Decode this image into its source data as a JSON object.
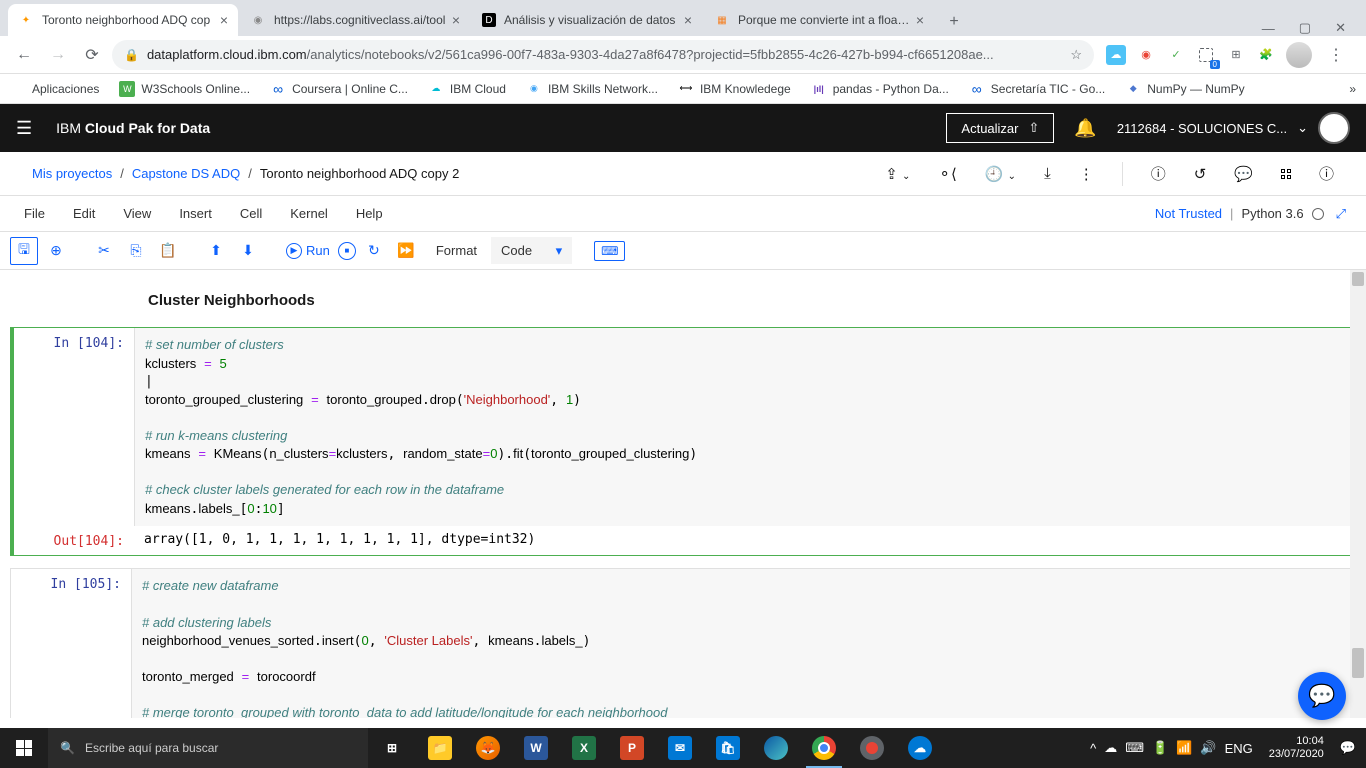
{
  "tabs": [
    {
      "title": "Toronto neighborhood ADQ cop",
      "icon": "✦"
    },
    {
      "title": "https://labs.cognitiveclass.ai/tool",
      "icon": "◉"
    },
    {
      "title": "Análisis y visualización de datos",
      "icon": "D"
    },
    {
      "title": "Porque me convierte int a float, a",
      "icon": "▦"
    }
  ],
  "url": {
    "domain": "dataplatform.cloud.ibm.com",
    "path": "/analytics/notebooks/v2/561ca996-00f7-483a-9303-4da27a8f6478?projectid=5fbb2855-4c26-427b-b994-cf6651208ae..."
  },
  "bookmarks": [
    {
      "label": "Aplicaciones",
      "color": "#ea4335"
    },
    {
      "label": "W3Schools Online...",
      "color": "#4caf50"
    },
    {
      "label": "Coursera | Online C...",
      "color": "#0056d2"
    },
    {
      "label": "IBM Cloud",
      "color": "#00bcd4"
    },
    {
      "label": "IBM Skills Network...",
      "color": "#42a5f5"
    },
    {
      "label": "IBM Knowledege",
      "color": "#000"
    },
    {
      "label": "pandas - Python Da...",
      "color": "#673ab7"
    },
    {
      "label": "Secretaría TIC - Go...",
      "color": "#0056d2"
    },
    {
      "label": "NumPy — NumPy",
      "color": "#4d77cf"
    }
  ],
  "ibm": {
    "title_prefix": "IBM ",
    "title_bold": "Cloud Pak for Data",
    "update": "Actualizar",
    "user": "2112684 - SOLUCIONES C..."
  },
  "breadcrumb": {
    "l1": "Mis proyectos",
    "l2": "Capstone DS ADQ",
    "current": "Toronto neighborhood ADQ copy 2"
  },
  "jupyter_menu": [
    "File",
    "Edit",
    "View",
    "Insert",
    "Cell",
    "Kernel",
    "Help"
  ],
  "trust": {
    "not_trusted": "Not Trusted",
    "kernel": "Python 3.6"
  },
  "toolbar": {
    "run": "Run",
    "format": "Format",
    "celltype": "Code"
  },
  "md_heading": "Cluster Neighborhoods",
  "cell104": {
    "prompt": "In [104]:",
    "out_prompt": "Out[104]:",
    "output": "array([1, 0, 1, 1, 1, 1, 1, 1, 1, 1], dtype=int32)"
  },
  "cell105": {
    "prompt": "In [105]:"
  },
  "taskbar": {
    "search": "Escribe aquí para buscar",
    "lang": "ENG",
    "time": "10:04",
    "date": "23/07/2020"
  }
}
